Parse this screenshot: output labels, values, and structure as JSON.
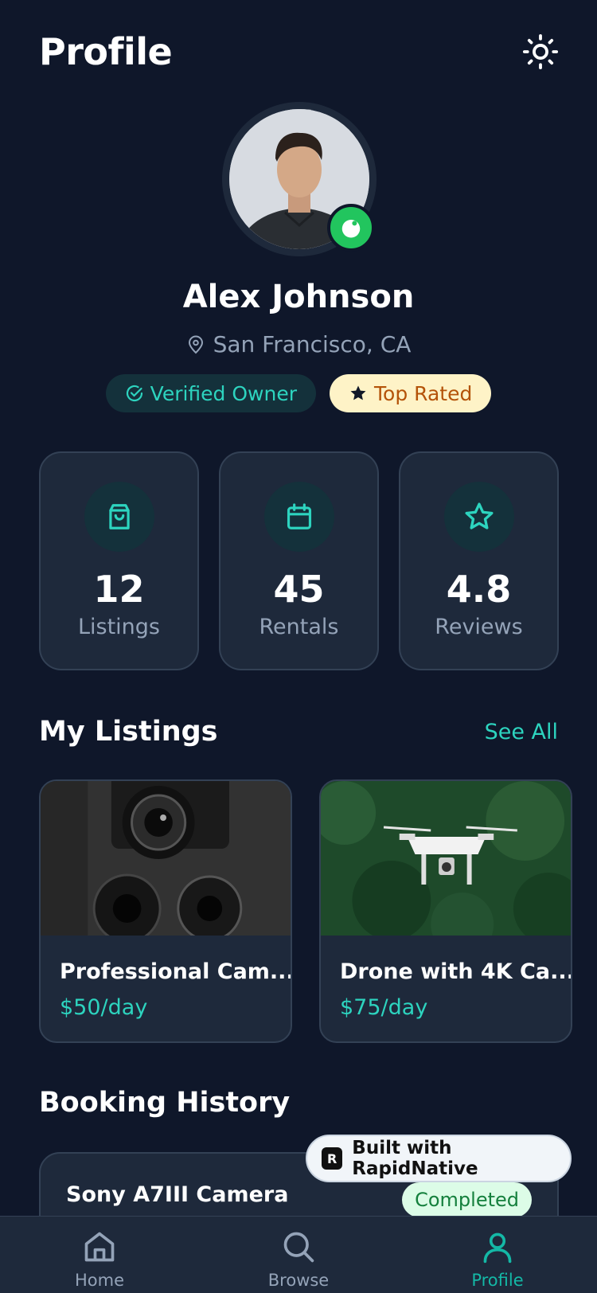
{
  "header": {
    "title": "Profile"
  },
  "profile": {
    "name": "Alex Johnson",
    "location": "San Francisco, CA",
    "badges": {
      "verified": "Verified Owner",
      "top_rated": "Top Rated"
    }
  },
  "stats": [
    {
      "value": "12",
      "label": "Listings",
      "icon": "shopping-bag-icon"
    },
    {
      "value": "45",
      "label": "Rentals",
      "icon": "calendar-icon"
    },
    {
      "value": "4.8",
      "label": "Reviews",
      "icon": "star-icon"
    }
  ],
  "my_listings": {
    "title": "My Listings",
    "see_all": "See All",
    "items": [
      {
        "title": "Professional Cam...",
        "price": "$50/day"
      },
      {
        "title": "Drone with 4K Ca...",
        "price": "$75/day"
      }
    ]
  },
  "booking_history": {
    "title": "Booking History",
    "items": [
      {
        "name": "Sony A7III Camera",
        "status": "Completed"
      }
    ]
  },
  "promo": {
    "label": "Built with RapidNative",
    "logo_letter": "R"
  },
  "nav": [
    {
      "label": "Home",
      "icon": "home-icon"
    },
    {
      "label": "Browse",
      "icon": "search-icon"
    },
    {
      "label": "Profile",
      "icon": "user-icon",
      "active": true
    }
  ],
  "colors": {
    "accent": "#2dd4bf",
    "background": "#0f172a",
    "card": "#1e293b",
    "online": "#22c55e"
  }
}
